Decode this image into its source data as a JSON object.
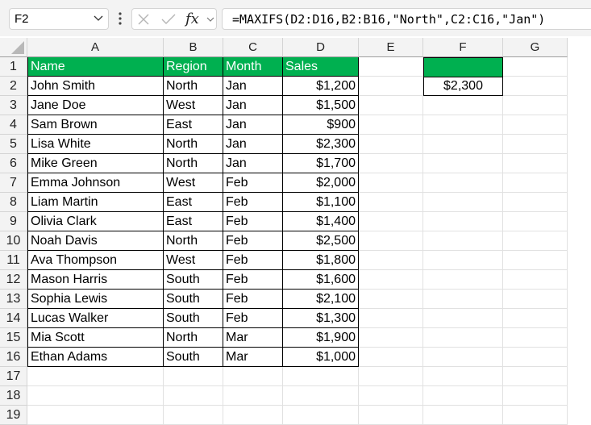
{
  "formula_bar": {
    "name_box": "F2",
    "formula": "=MAXIFS(D2:D16,B2:B16,\"North\",C2:C16,\"Jan\")",
    "icons": [
      "cancel-icon",
      "enter-check-icon",
      "insert-function-icon"
    ]
  },
  "columns": [
    "A",
    "B",
    "C",
    "D",
    "E",
    "F",
    "G"
  ],
  "rows": [
    "1",
    "2",
    "3",
    "4",
    "5",
    "6",
    "7",
    "8",
    "9",
    "10",
    "11",
    "12",
    "13",
    "14",
    "15",
    "16",
    "17",
    "18",
    "19"
  ],
  "table": {
    "headers": [
      "Name",
      "Region",
      "Month",
      "Sales"
    ],
    "rows": [
      [
        "John Smith",
        "North",
        "Jan",
        "$1,200"
      ],
      [
        "Jane Doe",
        "West",
        "Jan",
        "$1,500"
      ],
      [
        "Sam Brown",
        "East",
        "Jan",
        "$900"
      ],
      [
        "Lisa White",
        "North",
        "Jan",
        "$2,300"
      ],
      [
        "Mike Green",
        "North",
        "Jan",
        "$1,700"
      ],
      [
        "Emma Johnson",
        "West",
        "Feb",
        "$2,000"
      ],
      [
        "Liam Martin",
        "East",
        "Feb",
        "$1,100"
      ],
      [
        "Olivia Clark",
        "East",
        "Feb",
        "$1,400"
      ],
      [
        "Noah Davis",
        "North",
        "Feb",
        "$2,500"
      ],
      [
        "Ava Thompson",
        "West",
        "Feb",
        "$1,800"
      ],
      [
        "Mason Harris",
        "South",
        "Feb",
        "$1,600"
      ],
      [
        "Sophia Lewis",
        "South",
        "Feb",
        "$2,100"
      ],
      [
        "Lucas Walker",
        "South",
        "Feb",
        "$1,300"
      ],
      [
        "Mia Scott",
        "North",
        "Mar",
        "$1,900"
      ],
      [
        "Ethan Adams",
        "South",
        "Mar",
        "$1,000"
      ]
    ]
  },
  "result": {
    "header": "",
    "value": "$2,300"
  },
  "colors": {
    "header_fill": "#00b050",
    "header_text": "#ffffff"
  }
}
